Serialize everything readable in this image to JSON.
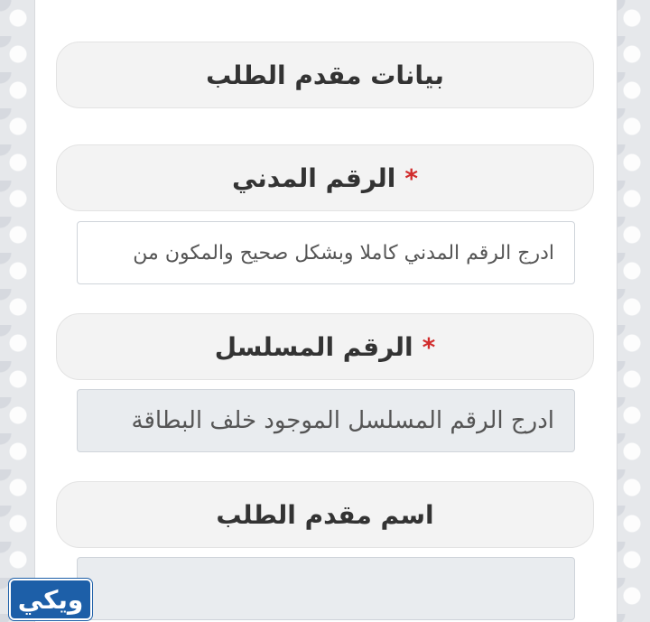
{
  "section": {
    "title": "بيانات مقدم الطلب"
  },
  "fields": {
    "civil_id": {
      "label": "الرقم المدني",
      "required_mark": "*",
      "placeholder": "ادرج الرقم المدني كاملا وبشكل صحيح والمكون من"
    },
    "serial_number": {
      "label": "الرقم المسلسل",
      "required_mark": "*",
      "placeholder": "ادرج الرقم المسلسل الموجود خلف البطاقة"
    },
    "applicant_name": {
      "label": "اسم مقدم الطلب",
      "value": ""
    }
  },
  "watermark": {
    "text": "ويكي"
  },
  "colors": {
    "required": "#d12c2c",
    "label_bg": "#f3f3f3",
    "disabled_field_bg": "#e9ecef",
    "watermark_bg": "#1d5fa8"
  }
}
